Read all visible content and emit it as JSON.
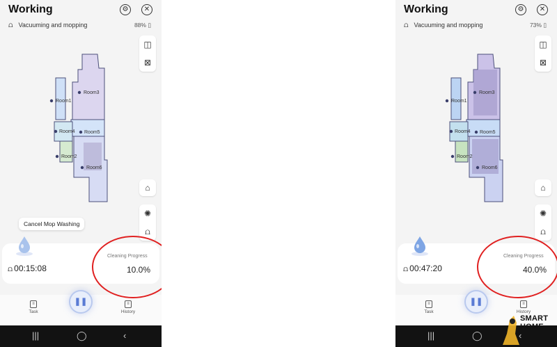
{
  "screens": [
    {
      "title": "Working",
      "mode": "Vacuuming and mopping",
      "battery": "88%",
      "tooltip": "Cancel Mop Washing",
      "timer": "00:15:08",
      "progress_label": "Cleaning Progress",
      "progress_value": "10.0%",
      "tabs": [
        {
          "label": "Task"
        },
        {
          "label": "History"
        }
      ],
      "rooms": [
        "Room1",
        "Room2",
        "Room3",
        "Room4",
        "Room5",
        "Room6"
      ]
    },
    {
      "title": "Working",
      "mode": "Vacuuming and mopping",
      "battery": "73%",
      "timer": "00:47:20",
      "progress_label": "Cleaning Progress",
      "progress_value": "40.0%",
      "tabs": [
        {
          "label": "Task"
        },
        {
          "label": "History"
        }
      ],
      "rooms": [
        "Room1",
        "Room2",
        "Room3",
        "Room4",
        "Room5",
        "Room6"
      ]
    }
  ],
  "icons": {
    "settings": "settings-icon",
    "close": "close-icon",
    "map_3d": "3d-view-icon",
    "map_edit": "map-edit-icon",
    "home": "dock-home-icon",
    "suction": "suction-fan-icon",
    "mop": "mop-icon",
    "pause": "pause-icon"
  },
  "colors": {
    "accent": "#5a7bd4",
    "annotation_red": "#e02020",
    "room_purple": "#dcd6ef",
    "room_blue": "#cfe0f7",
    "room_green": "#d5ead0"
  },
  "watermark": {
    "line1": "SMART",
    "line2": "HOME"
  }
}
